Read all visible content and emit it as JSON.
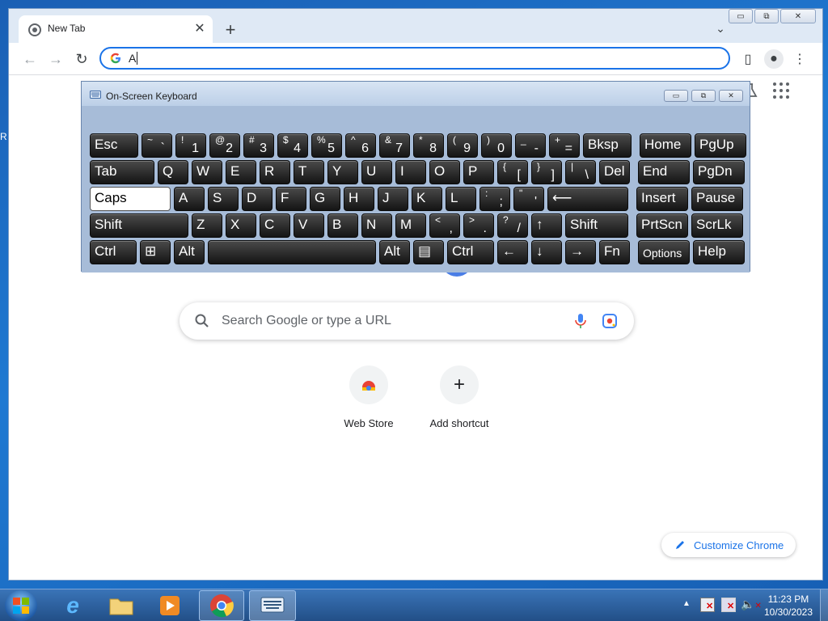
{
  "desktop": {
    "edge_letter": "R"
  },
  "browser": {
    "tab_title": "New Tab",
    "omnibox_value": "A",
    "search_placeholder": "Search Google or type a URL",
    "shortcuts": [
      {
        "label": "Web Store"
      },
      {
        "label": "Add shortcut"
      }
    ],
    "customize_label": "Customize Chrome"
  },
  "osk": {
    "title": "On-Screen Keyboard",
    "rows": [
      [
        {
          "id": "esc",
          "main": "Esc"
        },
        {
          "id": "tilde",
          "shift": "~",
          "low": "`"
        },
        {
          "id": "1",
          "shift": "!",
          "low": "1"
        },
        {
          "id": "2",
          "shift": "@",
          "low": "2"
        },
        {
          "id": "3",
          "shift": "#",
          "low": "3"
        },
        {
          "id": "4",
          "shift": "$",
          "low": "4"
        },
        {
          "id": "5",
          "shift": "%",
          "low": "5"
        },
        {
          "id": "6",
          "shift": "^",
          "low": "6"
        },
        {
          "id": "7",
          "shift": "&",
          "low": "7"
        },
        {
          "id": "8",
          "shift": "*",
          "low": "8"
        },
        {
          "id": "9",
          "shift": "(",
          "low": "9"
        },
        {
          "id": "0",
          "shift": ")",
          "low": "0"
        },
        {
          "id": "minus",
          "shift": "_",
          "low": "-"
        },
        {
          "id": "equals",
          "shift": "+",
          "low": "="
        },
        {
          "id": "bksp",
          "main": "Bksp"
        },
        {
          "id": "home",
          "main": "Home"
        },
        {
          "id": "pgup",
          "main": "PgUp"
        }
      ],
      [
        {
          "id": "tab",
          "main": "Tab"
        },
        {
          "id": "q",
          "main": "Q"
        },
        {
          "id": "w",
          "main": "W"
        },
        {
          "id": "e",
          "main": "E"
        },
        {
          "id": "r",
          "main": "R"
        },
        {
          "id": "t",
          "main": "T"
        },
        {
          "id": "y",
          "main": "Y"
        },
        {
          "id": "u",
          "main": "U"
        },
        {
          "id": "i",
          "main": "I"
        },
        {
          "id": "o",
          "main": "O"
        },
        {
          "id": "p",
          "main": "P"
        },
        {
          "id": "lbracket",
          "shift": "{",
          "low": "["
        },
        {
          "id": "rbracket",
          "shift": "}",
          "low": "]"
        },
        {
          "id": "backslash",
          "shift": "|",
          "low": "\\"
        },
        {
          "id": "del",
          "main": "Del"
        },
        {
          "id": "end",
          "main": "End"
        },
        {
          "id": "pgdn",
          "main": "PgDn"
        }
      ],
      [
        {
          "id": "caps",
          "main": "Caps",
          "active": true
        },
        {
          "id": "a",
          "main": "A"
        },
        {
          "id": "s",
          "main": "S"
        },
        {
          "id": "d",
          "main": "D"
        },
        {
          "id": "f",
          "main": "F"
        },
        {
          "id": "g",
          "main": "G"
        },
        {
          "id": "h",
          "main": "H"
        },
        {
          "id": "j",
          "main": "J"
        },
        {
          "id": "k",
          "main": "K"
        },
        {
          "id": "l",
          "main": "L"
        },
        {
          "id": "semicolon",
          "shift": ":",
          "low": ";"
        },
        {
          "id": "quote",
          "shift": "\"",
          "low": "'"
        },
        {
          "id": "enter",
          "main": "⟵"
        },
        {
          "id": "insert",
          "main": "Insert"
        },
        {
          "id": "pause",
          "main": "Pause"
        }
      ],
      [
        {
          "id": "lshift",
          "main": "Shift"
        },
        {
          "id": "z",
          "main": "Z"
        },
        {
          "id": "x",
          "main": "X"
        },
        {
          "id": "c",
          "main": "C"
        },
        {
          "id": "v",
          "main": "V"
        },
        {
          "id": "b",
          "main": "B"
        },
        {
          "id": "n",
          "main": "N"
        },
        {
          "id": "m",
          "main": "M"
        },
        {
          "id": "comma",
          "shift": "<",
          "low": ","
        },
        {
          "id": "period",
          "shift": ">",
          "low": "."
        },
        {
          "id": "slash",
          "shift": "?",
          "low": "/"
        },
        {
          "id": "up",
          "main": "↑"
        },
        {
          "id": "rshift",
          "main": "Shift"
        },
        {
          "id": "prtscn",
          "main": "PrtScn"
        },
        {
          "id": "scrlk",
          "main": "ScrLk"
        }
      ],
      [
        {
          "id": "lctrl",
          "main": "Ctrl"
        },
        {
          "id": "win",
          "main": "⊞"
        },
        {
          "id": "lalt",
          "main": "Alt"
        },
        {
          "id": "space",
          "main": ""
        },
        {
          "id": "ralt",
          "main": "Alt"
        },
        {
          "id": "menu",
          "main": "▤"
        },
        {
          "id": "rctrl",
          "main": "Ctrl"
        },
        {
          "id": "left",
          "main": "←"
        },
        {
          "id": "down",
          "main": "↓"
        },
        {
          "id": "right",
          "main": "→"
        },
        {
          "id": "fn",
          "main": "Fn"
        },
        {
          "id": "options",
          "main": "Options"
        },
        {
          "id": "help",
          "main": "Help"
        }
      ]
    ]
  },
  "taskbar": {
    "time": "11:23 PM",
    "date": "10/30/2023"
  },
  "colors": {
    "accent": "#1a73e8",
    "osk_bg": "#a7bcd8",
    "taskbar": "#2a5e9e"
  }
}
